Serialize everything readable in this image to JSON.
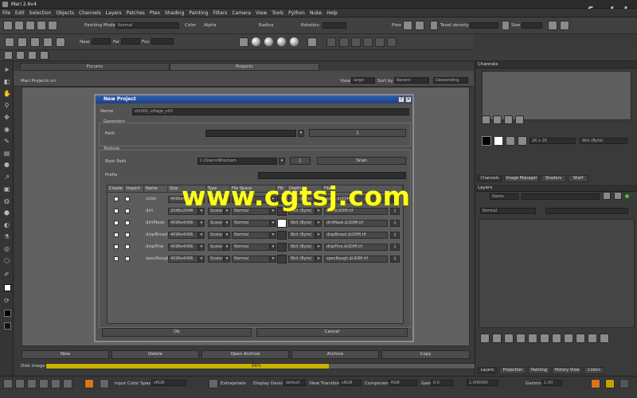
{
  "app": {
    "title": "Mari 2.6v4",
    "logo_text": "fxphd"
  },
  "menu": [
    "File",
    "Edit",
    "Selection",
    "Objects",
    "Channels",
    "Layers",
    "Patches",
    "Ptex",
    "Shading",
    "Painting",
    "Filters",
    "Camera",
    "View",
    "Tools",
    "Python",
    "Nuke",
    "Help"
  ],
  "toolbar": {
    "paint_mode": "Painting Mode",
    "paint_mode_value": "Normal",
    "color_label": "Color",
    "alpha_label": "Alpha",
    "radius_label": "Radius",
    "rotation_label": "Rotation",
    "ptex_label": "Ptex",
    "texel_density_label": "Texel density",
    "size_label": "Size",
    "near_label": "Near",
    "far_label": "Far",
    "fov_label": "Fov"
  },
  "project_tabs": {
    "forums": "Forums",
    "projects": "Projects"
  },
  "project_header": {
    "location": "Mari Projects on",
    "view_label": "View",
    "view_value": "large",
    "sort_label": "Sort by",
    "sort_value": "Recent",
    "order_value": "Descending"
  },
  "dialog": {
    "title": "New Project",
    "name_label": "Name",
    "name_value": "vfx301_village_v02",
    "geometry_label": "Geometry",
    "path_label": "Path",
    "texture_label": "Texture",
    "root_path_label": "Root Path",
    "root_path_value": "C:/Users/Wreckam",
    "scan_label": "Scan",
    "prefix_label": "Prefix",
    "columns": [
      "Create",
      "Import",
      "Name",
      "Size",
      "Type",
      "File Space",
      "Fill",
      "Depth",
      "Files"
    ],
    "rows": [
      {
        "name": "color",
        "size": "4096x4096",
        "type": "Color",
        "space": "Normal",
        "depth": "8bit (Byte)",
        "file": "color.$UDIM.tif",
        "fill": "#3a3a3a"
      },
      {
        "name": "dirt",
        "size": "2048x2048",
        "type": "Scalar",
        "space": "Normal",
        "depth": "8bit (Byte)",
        "file": "dirt.$UDIM.tif",
        "fill": "#3a3a3a"
      },
      {
        "name": "dirtMask",
        "size": "4096x4096",
        "type": "Scalar",
        "space": "Normal",
        "depth": "8bit (Byte)",
        "file": "dirtMask.$UDIM.tif",
        "fill": "#ffffff"
      },
      {
        "name": "dispBroad",
        "size": "4096x4096",
        "type": "Scalar",
        "space": "Normal",
        "depth": "8bit (Byte)",
        "file": "dispBroad.$UDIM.tif",
        "fill": "#3a3a3a"
      },
      {
        "name": "dispFine",
        "size": "4096x4096",
        "type": "Scalar",
        "space": "Normal",
        "depth": "8bit (Byte)",
        "file": "dispFine.$UDIM.tif",
        "fill": "#3a3a3a"
      },
      {
        "name": "specRough",
        "size": "4096x4096",
        "type": "Scalar",
        "space": "Normal",
        "depth": "8bit (Byte)",
        "file": "specRough.$UDIM.tif",
        "fill": "#3a3a3a"
      }
    ],
    "ok_label": "Ok",
    "cancel_label": "Cancel"
  },
  "bottom_buttons": [
    "New",
    "Delete",
    "Open Archive",
    "Archive",
    "Copy"
  ],
  "disk": {
    "label": "Disk Usage",
    "percent_text": "66%",
    "fill_fraction": 0.66,
    "fill_color": "#c9b200"
  },
  "status": {
    "input_cs_label": "Input Color Space",
    "input_cs_value": "sRGB",
    "extrapolate_label": "Extrapolate",
    "display_device_label": "Display Device",
    "display_device_value": "default",
    "view_transform_label": "View Transform",
    "view_transform_value": "sRGB",
    "component_label": "Component",
    "component_value": "RGB",
    "gain_label": "Gain",
    "gain_value": "0.0",
    "gain_num": "1.000000",
    "gamma_label": "Gamma",
    "gamma_value": "1.00"
  },
  "right_panel": {
    "channels_title": "Channels",
    "channel_tabs": [
      "Channels",
      "Image Manager",
      "Shaders",
      "Shelf"
    ],
    "layers_title": "Layers",
    "layers_name_value": "Name",
    "blend_value": "Normal",
    "bottom_tabs": [
      "Layers",
      "Projection",
      "Painting",
      "History View",
      "Colors"
    ],
    "channel_size_value": "2K x 2K",
    "channel_depth_value": "8bit (Byte)"
  },
  "watermark": "www.cgtsj.com"
}
